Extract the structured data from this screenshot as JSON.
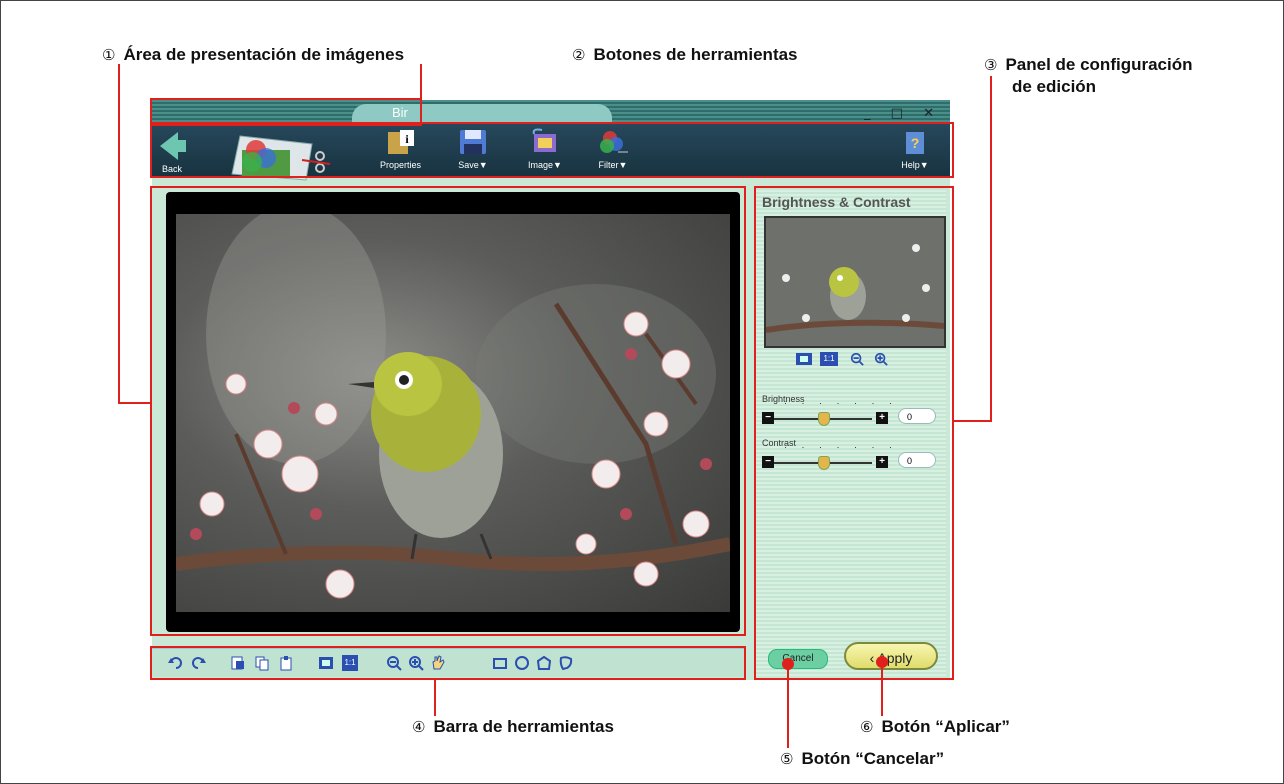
{
  "callouts": {
    "c1": {
      "num": "①",
      "text": "Área de presentación de imágenes"
    },
    "c2": {
      "num": "②",
      "text": "Botones de herramientas"
    },
    "c3": {
      "num": "③",
      "line1": "Panel de configuración",
      "line2": "de edición"
    },
    "c4": {
      "num": "④",
      "text": "Barra de herramientas"
    },
    "c5": {
      "num": "⑤",
      "text": "Botón “Cancelar”"
    },
    "c6": {
      "num": "⑥",
      "text": "Botón “Aplicar”"
    }
  },
  "window": {
    "title": "Bir",
    "controls": "_ □ ✕"
  },
  "toolbar": {
    "back_label": "Back",
    "properties_label": "Properties",
    "save_label": "Save▼",
    "image_label": "Image▼",
    "filter_label": "Filter▼",
    "help_label": "Help▼"
  },
  "panel": {
    "title": "Brightness & Contrast",
    "brightness_label": "Brightness",
    "brightness_value": "0",
    "brightness_level": 0.5,
    "contrast_label": "Contrast",
    "contrast_value": "0",
    "contrast_level": 0.5,
    "ticks": "· · · · · · ·",
    "cancel_label": "Cancel",
    "apply_label": "Apply",
    "zoom_fit_label": "⛶",
    "zoom_one_label": "1:1"
  },
  "bottom": {
    "zoom_one_label": "1:1"
  },
  "colors": {
    "callout_red": "#e0201c",
    "toolbar_bg": "#1e3b4a",
    "panel_bg": "#d0ecdc"
  }
}
